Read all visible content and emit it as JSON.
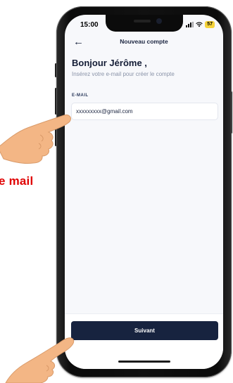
{
  "annotation": {
    "text": "e mail"
  },
  "status_bar": {
    "time": "15:00",
    "battery": "57"
  },
  "nav": {
    "title": "Nouveau compte"
  },
  "content": {
    "greeting": "Bonjour Jérôme ,",
    "subtitle": "Insérez votre e-mail pour créer le compte",
    "email": {
      "label": "E-MAIL",
      "value": "xxxxxxxxx@gmail.com"
    }
  },
  "footer": {
    "next_label": "Suivant"
  },
  "colors": {
    "primary": "#17233f",
    "annotation": "#e00000",
    "battery": "#f5d33a",
    "skin": "#f3b685"
  },
  "icons": {
    "back": "arrow-left-icon",
    "signal": "signal-icon",
    "wifi": "wifi-icon",
    "battery": "battery-icon",
    "hand": "pointing-hand-icon"
  }
}
